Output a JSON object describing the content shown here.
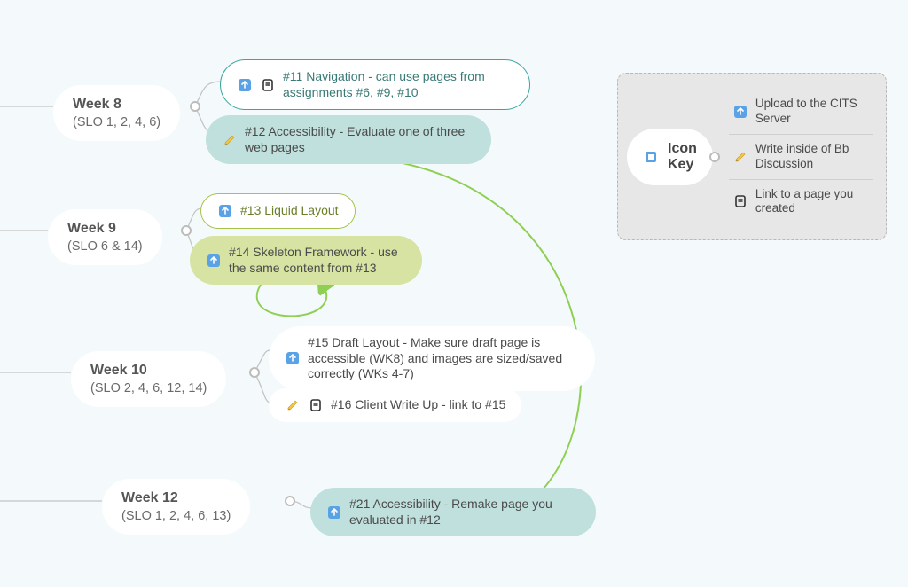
{
  "weeks": {
    "w8": {
      "title": "Week 8",
      "sub": "(SLO 1, 2, 4, 6)"
    },
    "w9": {
      "title": "Week 9",
      "sub": "(SLO 6 & 14)"
    },
    "w10": {
      "title": "Week 10",
      "sub": "(SLO 2, 4, 6, 12, 14)"
    },
    "w12": {
      "title": "Week 12",
      "sub": "(SLO 1, 2, 4, 6, 13)"
    }
  },
  "tasks": {
    "t11": "#11 Navigation - can use pages from assignments #6, #9, #10",
    "t12": "#12 Accessibility - Evaluate one of three web pages",
    "t13": "#13 Liquid Layout",
    "t14": "#14 Skeleton Framework - use the same content from #13",
    "t15": "#15 Draft Layout - Make sure draft page is accessible (WK8) and images are sized/saved correctly (WKs 4-7)",
    "t16": "#16 Client Write Up - link to #15",
    "t21": "#21 Accessibility - Remake page you evaluated in #12"
  },
  "legend": {
    "title_line1": "Icon",
    "title_line2": "Key",
    "items": {
      "upload": "Upload to the CITS Server",
      "write": "Write inside of Bb Discussion",
      "link": "Link to a page you created"
    }
  }
}
